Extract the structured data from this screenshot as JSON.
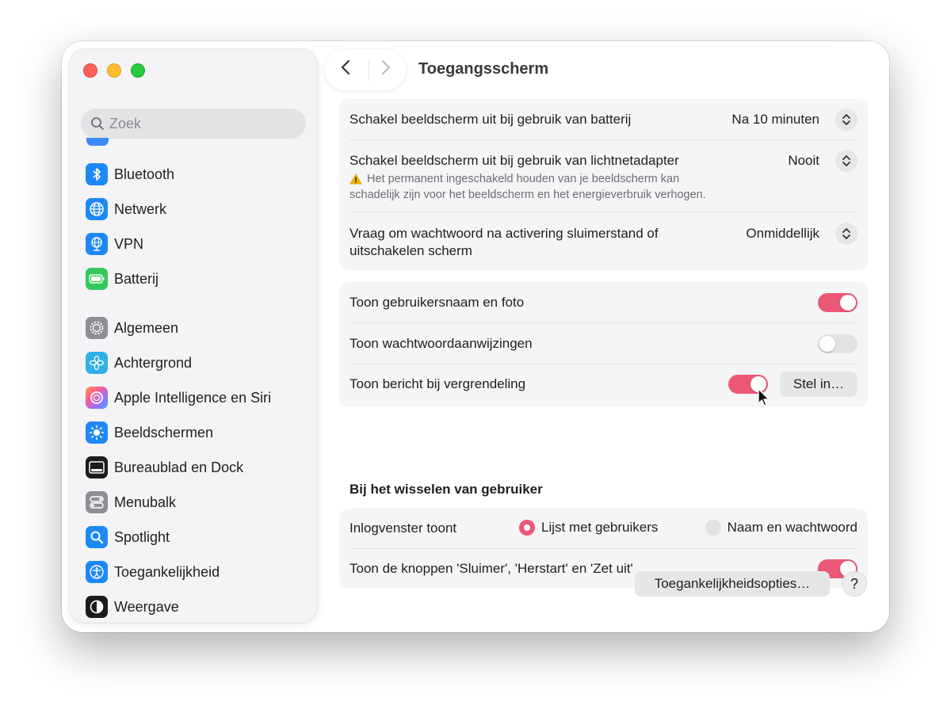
{
  "sidebar": {
    "search_placeholder": "Zoek",
    "items": [
      {
        "label": "Bluetooth",
        "icon": "bluetooth-icon",
        "color": "#1e88f5"
      },
      {
        "label": "Netwerk",
        "icon": "globe-icon",
        "color": "#1e88f5"
      },
      {
        "label": "VPN",
        "icon": "vpn-globe-icon",
        "color": "#1e88f5"
      },
      {
        "label": "Batterij",
        "icon": "battery-icon",
        "color": "#34c759"
      },
      {
        "label": "Algemeen",
        "icon": "gear-icon",
        "color": "#8e8e93"
      },
      {
        "label": "Achtergrond",
        "icon": "flower-icon",
        "color": "#30b0e6"
      },
      {
        "label": "Apple Intelligence en Siri",
        "icon": "siri-icon",
        "color": "#c86dd7"
      },
      {
        "label": "Beeldschermen",
        "icon": "sun-icon",
        "color": "#1e88f5"
      },
      {
        "label": "Bureaublad en Dock",
        "icon": "dock-icon",
        "color": "#1c1c1e"
      },
      {
        "label": "Menubalk",
        "icon": "toggles-icon",
        "color": "#8e8e93"
      },
      {
        "label": "Spotlight",
        "icon": "magnifier-icon",
        "color": "#1e88f5"
      },
      {
        "label": "Toegankelijkheid",
        "icon": "accessibility-icon",
        "color": "#1e88f5"
      },
      {
        "label": "Weergave",
        "icon": "appearance-icon",
        "color": "#1c1c1e"
      }
    ]
  },
  "header": {
    "title": "Toegangsscherm"
  },
  "group1": {
    "battery_label": "Schakel beeldscherm uit bij gebruik van batterij",
    "battery_value": "Na 10 minuten",
    "adapter_label": "Schakel beeldscherm uit bij gebruik van lichtnetadapter",
    "adapter_value": "Nooit",
    "adapter_warning_line1": "Het permanent ingeschakeld houden van je beeldscherm kan",
    "adapter_warning_line2": "schadelijk zijn voor het beeldscherm en het energieverbruik verhogen.",
    "password_label_line1": "Vraag om wachtwoord na activering sluimerstand of",
    "password_label_line2": "uitschakelen scherm",
    "password_value": "Onmiddellijk"
  },
  "group2": {
    "show_username_label": "Toon gebruikersnaam en foto",
    "show_username_on": true,
    "show_hints_label": "Toon wachtwoordaanwijzingen",
    "show_hints_on": false,
    "show_message_label": "Toon bericht bij vergrendeling",
    "show_message_on": true,
    "set_button_label": "Stel in…"
  },
  "switch_section": {
    "title": "Bij het wisselen van gebruiker",
    "login_window_label": "Inlogvenster toont",
    "option_list": "Lijst met gebruikers",
    "option_name": "Naam en wachtwoord",
    "selected": "Lijst met gebruikers",
    "buttons_label": "Toon de knoppen 'Sluimer', 'Herstart' en 'Zet uit'",
    "buttons_on": true
  },
  "footer": {
    "accessibility_options_label": "Toegankelijkheidsopties…",
    "help_label": "?"
  },
  "colors": {
    "accent": "#ec5874"
  }
}
